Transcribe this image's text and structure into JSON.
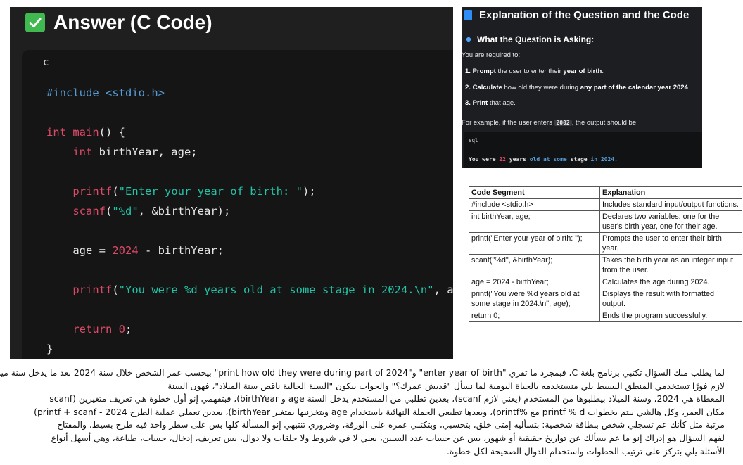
{
  "answer": {
    "title": "Answer (C Code)",
    "language": "c",
    "lines": {
      "l1_include": "#include",
      "l1_header": "<stdio.h>",
      "l2_int": "int",
      "l2_main": "main",
      "l2_rest": "() {",
      "l3_int": "int",
      "l3_rest": " birthYear, age;",
      "l4_fn": "printf",
      "l4_open": "(",
      "l4_str": "\"Enter your year of birth: \"",
      "l4_close": ");",
      "l5_fn": "scanf",
      "l5_open": "(",
      "l5_str": "\"%d\"",
      "l5_rest": ", &birthYear);",
      "l6_pre": "age = ",
      "l6_num": "2024",
      "l6_rest": " - birthYear;",
      "l7_fn": "printf",
      "l7_open": "(",
      "l7_str": "\"You were %d years old at some stage in 2024.\\n\"",
      "l7_rest": ", age);",
      "l8_kw": "return",
      "l8_num": "0",
      "l8_semi": ";",
      "l9": "}"
    }
  },
  "explanation": {
    "title": "Explanation of the Question and the Code",
    "question_heading": "What the Question is Asking:",
    "intro": "You are required to:",
    "steps": [
      {
        "num": "1.",
        "pre": "Prompt",
        "mid": " the user to enter their ",
        "bold2": "year of birth",
        "post": "."
      },
      {
        "num": "2.",
        "pre": "Calculate",
        "mid": " how old they were during ",
        "bold2": "any part of the calendar year 2024",
        "post": "."
      },
      {
        "num": "3.",
        "pre": "Print",
        "mid": " that age.",
        "bold2": "",
        "post": ""
      }
    ],
    "example_pre": "For example, if the user enters ",
    "example_code": "2002",
    "example_post": ", the output should be:",
    "mini_lang": "sql",
    "output": {
      "w1": "You were ",
      "n": "22",
      "w2": " years ",
      "k1": "old at some",
      "w3": " stage ",
      "k2": "in 2024."
    }
  },
  "table": {
    "headers": [
      "Code Segment",
      "Explanation"
    ],
    "rows": [
      {
        "code": "#include <stdio.h>",
        "desc": "Includes standard input/output functions."
      },
      {
        "code": "int birthYear, age;",
        "desc": "Declares two variables: one for the user's birth year, one for their age."
      },
      {
        "code": "printf(\"Enter your year of birth: \");",
        "desc": "Prompts the user to enter their birth year."
      },
      {
        "code": "scanf(\"%d\", &birthYear);",
        "desc": "Takes the birth year as an integer input from the user."
      },
      {
        "code": "age = 2024 - birthYear;",
        "desc": "Calculates the age during 2024."
      },
      {
        "code": "printf(\"You were %d years old at some stage in 2024.\\n\", age);",
        "desc": "Displays the result with formatted output."
      },
      {
        "code": "return 0;",
        "desc": "Ends the program successfully."
      }
    ]
  },
  "arabic_paragraph": [
    "لما يطلب منك السؤال تكتبي برنامج بلغة C، فبمجرد ما تقري \"enter year of birth\" و\"print how old they were during part of 2024\" بيحسب عمر الشخص خلال سنة 2024 بعد ما يدخل سنة ميلاده،",
    "لازم فورًا تستخدمي المنطق البسيط يلي منستخدمه بالحياة اليومية لما نسأل \"قديش عمرك؟\" والجواب بيكون \"السنة الحالية ناقص سنة الميلاد\"، فهون السنة",
    "المعطاة هي 2024، وسنة الميلاد بيطلبوها من المستخدم (يعني لازم scanf)، بعدين تطلبي من المستخدم يدخل السنة age و birthYear)، فبتفهمي إنو أول خطوة هي تعريف متغيرين (scanf",
    "مكان العمر، وكل هالشي بيتم بخطوات printf % d مع %printf)، وبعدها تطبعي الجملة النهائية باستخدام age وبتخزنيها بمتغير birthYear)، بعدين تعملي عملية الطرح 2024 - printf + scanf)",
    "مرتبة متل كأنك عم تسجلي شخص ببطاقة شخصية: بتسأليه إمتى خلق، بتحسبي، وبتكتبي عمره على الورقة، وضروري تنتبهي إنو المسألة كلها بس على سطر واحد فيه طرح بسيط، والمفتاح",
    "لفهم السؤال هو إدراك إنو ما عم يسألك عن تواريخ حقيقية أو شهور، بس عن حساب عدد السنين، يعني لا في شروط ولا حلقات ولا دوال، بس تعريف، إدخال، حساب، طباعة، وهي أسهل أنواع",
    "الأسئلة يلي بتركز على ترتيب الخطوات واستخدام الدوال الصحيحة لكل خطوة."
  ]
}
